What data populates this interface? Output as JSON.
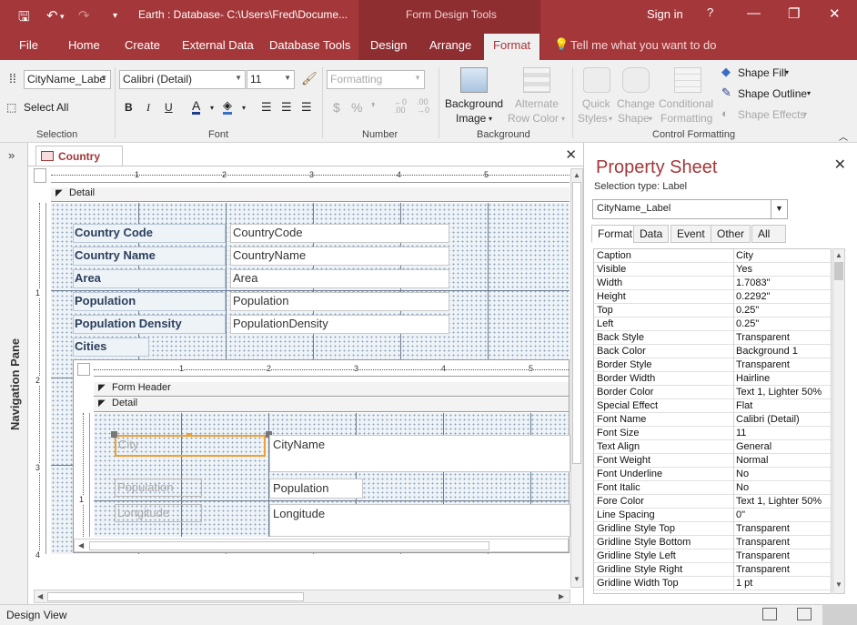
{
  "titlebar": {
    "title": "Earth : Database- C:\\Users\\Fred\\Docume...",
    "context_group": "Form Design Tools",
    "signin": "Sign in",
    "help": "?",
    "customize_qa": "▾"
  },
  "tabs": {
    "file": "File",
    "home": "Home",
    "create": "Create",
    "external": "External Data",
    "dbtools": "Database Tools",
    "design": "Design",
    "arrange": "Arrange",
    "format": "Format",
    "tellme": "Tell me what you want to do"
  },
  "ribbon": {
    "selection": {
      "object_combo": "CityName_Labe",
      "select_all": "Select All",
      "label": "Selection"
    },
    "font": {
      "font_name": "Calibri (Detail)",
      "font_size": "11",
      "bold": "B",
      "italic": "I",
      "underline": "U",
      "font_color": "A",
      "label": "Font"
    },
    "number": {
      "formatting": "Formatting",
      "currency": "$",
      "percent": "%",
      "label": "Number"
    },
    "background": {
      "bg_image_1": "Background",
      "bg_image_2": "Image",
      "alt_row_1": "Alternate",
      "alt_row_2": "Row Color",
      "label": "Background"
    },
    "control": {
      "quick_1": "Quick",
      "quick_2": "Styles",
      "change_1": "Change",
      "change_2": "Shape",
      "cond_1": "Conditional",
      "cond_2": "Formatting",
      "shape_fill": "Shape Fill",
      "shape_outline": "Shape Outline",
      "shape_effects": "Shape Effects",
      "label": "Control Formatting"
    }
  },
  "navpane": {
    "label": "Navigation Pane"
  },
  "document": {
    "tab_label": "Country",
    "detail_section": "Detail",
    "ruler_top": [
      "1",
      "2",
      "3",
      "4",
      "5"
    ],
    "ruler_left": [
      "1",
      "2",
      "3",
      "4"
    ],
    "fields": [
      {
        "label": "Country Code",
        "control": "CountryCode"
      },
      {
        "label": "Country Name",
        "control": "CountryName"
      },
      {
        "label": "Area",
        "control": "Area"
      },
      {
        "label": "Population",
        "control": "Population"
      },
      {
        "label": "Population Density",
        "control": "PopulationDensity"
      }
    ],
    "cities_label": "Cities",
    "subform": {
      "ruler_top": [
        "1",
        "2",
        "3",
        "4",
        "5"
      ],
      "ruler_left": [
        "1"
      ],
      "form_header": "Form Header",
      "detail": "Detail",
      "city_label": "City",
      "city_control": "CityName",
      "population_label": "Population",
      "population_control": "Population",
      "longitude_label": "Longitude",
      "longitude_control": "Longitude"
    }
  },
  "property_sheet": {
    "title": "Property Sheet",
    "selection_type": "Selection type:  Label",
    "selected_object": "CityName_Label",
    "tabs": [
      "Format",
      "Data",
      "Event",
      "Other",
      "All"
    ],
    "rows": [
      {
        "k": "Caption",
        "v": "City"
      },
      {
        "k": "Visible",
        "v": "Yes"
      },
      {
        "k": "Width",
        "v": "1.7083\""
      },
      {
        "k": "Height",
        "v": "0.2292\""
      },
      {
        "k": "Top",
        "v": "0.25\""
      },
      {
        "k": "Left",
        "v": "0.25\""
      },
      {
        "k": "Back Style",
        "v": "Transparent"
      },
      {
        "k": "Back Color",
        "v": "Background 1"
      },
      {
        "k": "Border Style",
        "v": "Transparent"
      },
      {
        "k": "Border Width",
        "v": "Hairline"
      },
      {
        "k": "Border Color",
        "v": "Text 1, Lighter 50%"
      },
      {
        "k": "Special Effect",
        "v": "Flat"
      },
      {
        "k": "Font Name",
        "v": "Calibri (Detail)"
      },
      {
        "k": "Font Size",
        "v": "11"
      },
      {
        "k": "Text Align",
        "v": "General"
      },
      {
        "k": "Font Weight",
        "v": "Normal"
      },
      {
        "k": "Font Underline",
        "v": "No"
      },
      {
        "k": "Font Italic",
        "v": "No"
      },
      {
        "k": "Fore Color",
        "v": "Text 1, Lighter 50%"
      },
      {
        "k": "Line Spacing",
        "v": "0\""
      },
      {
        "k": "Gridline Style Top",
        "v": "Transparent"
      },
      {
        "k": "Gridline Style Bottom",
        "v": "Transparent"
      },
      {
        "k": "Gridline Style Left",
        "v": "Transparent"
      },
      {
        "k": "Gridline Style Right",
        "v": "Transparent"
      },
      {
        "k": "Gridline Width Top",
        "v": "1 pt"
      }
    ]
  },
  "status": {
    "view": "Design View"
  },
  "colors": {
    "accent": "#a4373a",
    "context": "#8e2e31",
    "selection": "#f0a030"
  }
}
